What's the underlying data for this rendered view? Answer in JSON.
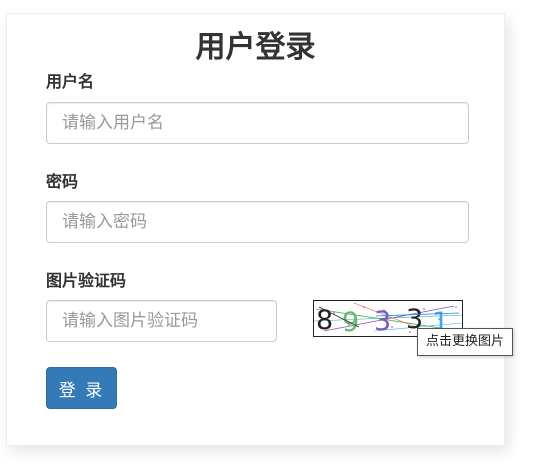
{
  "form": {
    "title": "用户登录",
    "username": {
      "label": "用户名",
      "value": "",
      "placeholder": "请输入用户名"
    },
    "password": {
      "label": "密码",
      "value": "",
      "placeholder": "请输入密码"
    },
    "captcha": {
      "label": "图片验证码",
      "value": "",
      "placeholder": "请输入图片验证码",
      "image_text": "89331",
      "tooltip": "点击更换图片"
    },
    "submit_label": "登 录"
  },
  "colors": {
    "primary_button": "#337ab7",
    "text": "#333333",
    "input_border": "#cccccc"
  }
}
